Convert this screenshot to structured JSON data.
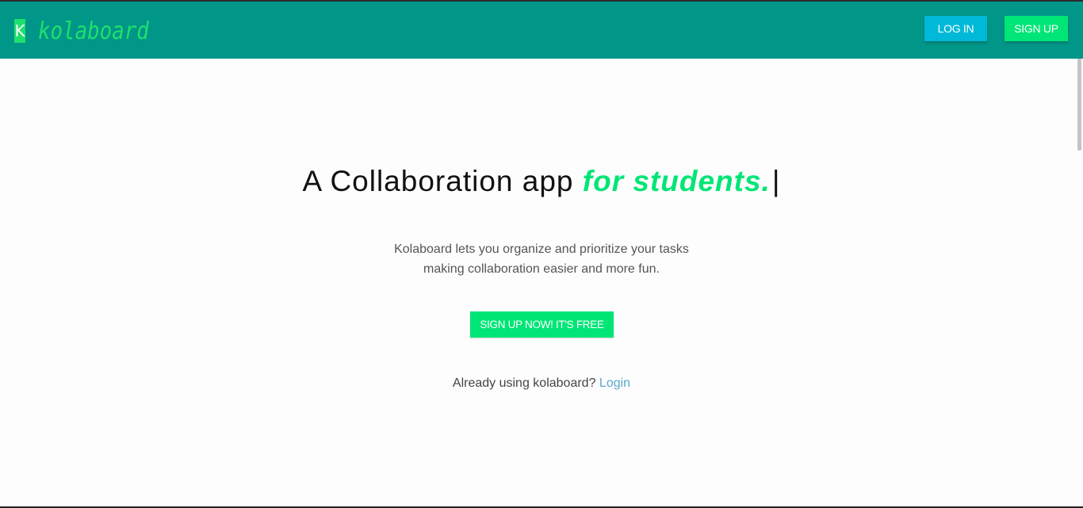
{
  "brand": {
    "mark": "K",
    "name": "kolaboard"
  },
  "nav": {
    "login_label": "LOG IN",
    "signup_label": "SIGN UP"
  },
  "hero": {
    "headline_prefix": "A Collaboration app ",
    "headline_accent": "for students.",
    "cursor": "|",
    "subtext_line1": "Kolaboard lets you organize and prioritize your tasks",
    "subtext_line2": "making collaboration easier and more fun.",
    "cta_label": "SIGN UP NOW! IT'S FREE",
    "already_text": "Already using kolaboard? ",
    "login_link": "Login"
  },
  "colors": {
    "navbar": "#009688",
    "accent_green": "#00e676",
    "login_button": "#00b9d8",
    "link": "#5aa7cf"
  }
}
